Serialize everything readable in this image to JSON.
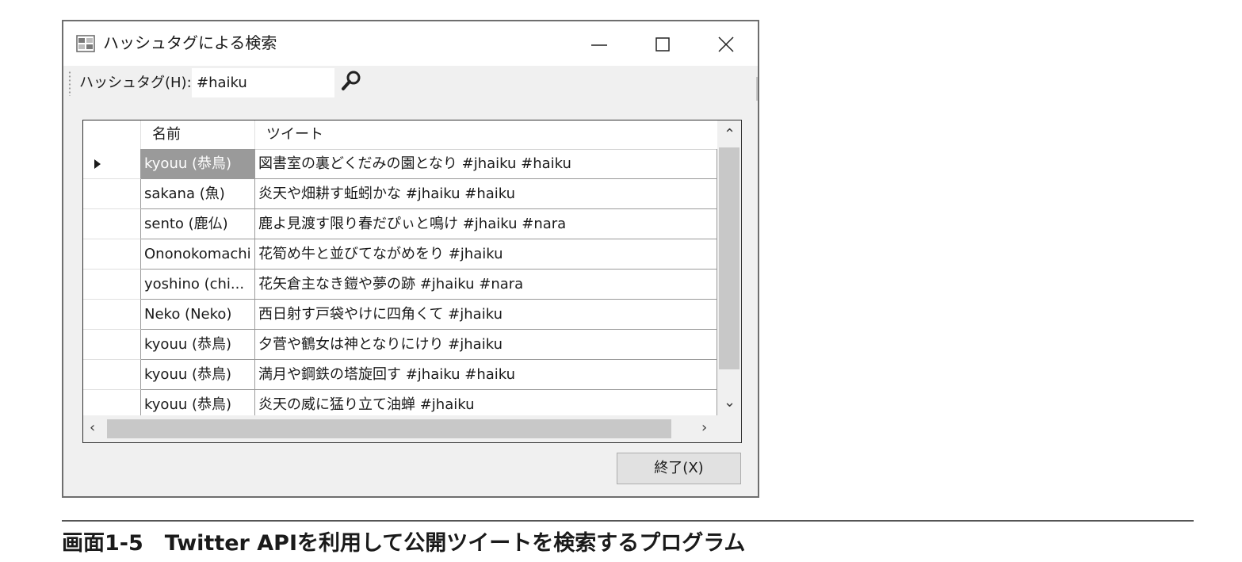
{
  "window": {
    "title": "ハッシュタグによる検索",
    "controls": {
      "minimize": "minimize-icon",
      "maximize": "maximize-icon",
      "close": "close-icon"
    }
  },
  "toolbar": {
    "label": "ハッシュタグ(H):",
    "hashtag_value": "#haiku",
    "search_icon": "search-icon"
  },
  "grid": {
    "columns": [
      "名前",
      "ツイート"
    ],
    "rows": [
      {
        "name": "kyouu (恭鳥)",
        "tweet": "図書室の裏どくだみの園となり #jhaiku #haiku",
        "current": true
      },
      {
        "name": "sakana (魚)",
        "tweet": "炎天や畑耕す蚯蚓かな #jhaiku #haiku"
      },
      {
        "name": "sento (鹿仏)",
        "tweet": "鹿よ見渡す限り春だぴぃと鳴け #jhaiku #nara"
      },
      {
        "name": "Ononokomachi",
        "tweet": "花筍め牛と並びてながめをり #jhaiku"
      },
      {
        "name": "yoshino (chi...",
        "tweet": "花矢倉主なき鎧や夢の跡 #jhaiku #nara"
      },
      {
        "name": "Neko (Neko)",
        "tweet": "西日射す戸袋やけに四角くて #jhaiku"
      },
      {
        "name": "kyouu (恭鳥)",
        "tweet": "夕菅や鶴女は神となりにけり #jhaiku"
      },
      {
        "name": "kyouu (恭鳥)",
        "tweet": "満月や鋼鉄の塔旋回す #jhaiku #haiku"
      },
      {
        "name": "kyouu (恭鳥)",
        "tweet": "炎天の威に猛り立て油蝉 #jhaiku"
      }
    ]
  },
  "buttons": {
    "close_label": "終了(X)"
  },
  "caption": "画面1-5　Twitter APIを利用して公開ツイートを検索するプログラム",
  "colors": {
    "selection": "#9a9a9a",
    "window_bg": "#f0f0f0"
  }
}
